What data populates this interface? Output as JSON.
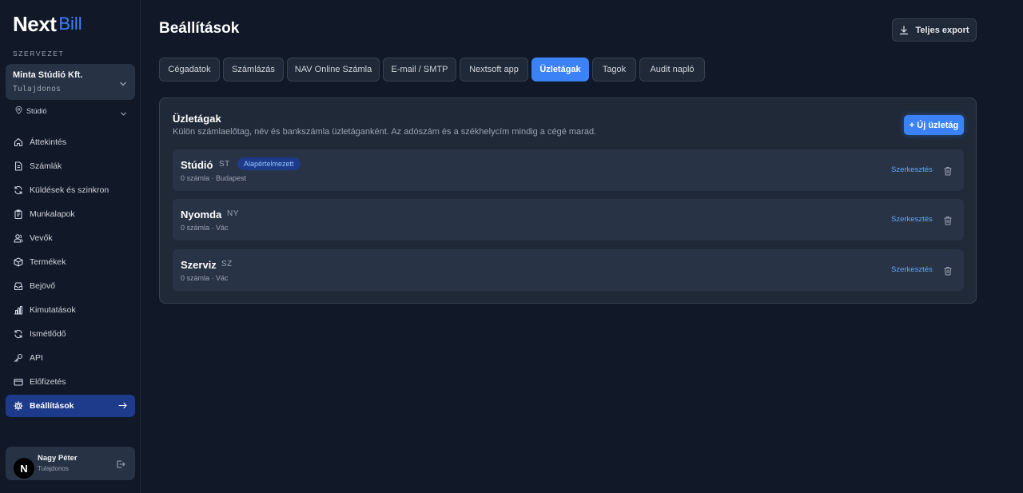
{
  "brand": {
    "name_main": "Next",
    "name_accent": "Bill",
    "accent_color": "#3b82f6"
  },
  "sidebar": {
    "org_section_label": "SZERVEZET",
    "org_name": "Minta Stúdió Kft.",
    "org_role": "Tulajdonos",
    "business_selector": "Stúdió",
    "items": [
      {
        "label": "Áttekintés",
        "icon": "home-icon"
      },
      {
        "label": "Számlák",
        "icon": "document-icon"
      },
      {
        "label": "Küldések és szinkron",
        "icon": "sync-icon"
      },
      {
        "label": "Munkalapok",
        "icon": "clipboard-icon"
      },
      {
        "label": "Vevők",
        "icon": "users-icon"
      },
      {
        "label": "Termékek",
        "icon": "box-icon"
      },
      {
        "label": "Bejövő",
        "icon": "inbox-icon"
      },
      {
        "label": "Kimutatások",
        "icon": "bar-chart-icon"
      },
      {
        "label": "Ismétlődő",
        "icon": "repeat-icon"
      },
      {
        "label": "API",
        "icon": "key-icon"
      },
      {
        "label": "Előfizetés",
        "icon": "credit-card-icon"
      },
      {
        "label": "Beállítások",
        "icon": "gear-icon",
        "active": true
      }
    ],
    "user": {
      "initial": "N",
      "name": "Nagy Péter",
      "role": "Tulajdonos"
    }
  },
  "header": {
    "title": "Beállítások",
    "export_label": "Teljes export"
  },
  "tabs": [
    {
      "label": "Cégadatok"
    },
    {
      "label": "Számlázás"
    },
    {
      "label": "NAV Online Számla"
    },
    {
      "label": "E-mail / SMTP"
    },
    {
      "label": "Nextsoft app"
    },
    {
      "label": "Üzletágak",
      "active": true
    },
    {
      "label": "Tagok"
    },
    {
      "label": "Audit napló"
    }
  ],
  "panel": {
    "title": "Üzletágak",
    "subtitle": "Külön számlaelőtag, név és bankszámla üzletáganként. Az adószám és a székhelycím mindig a cégé marad.",
    "new_button": "+ Új üzletág",
    "edit_label": "Szerkesztés",
    "rows": [
      {
        "name": "Stúdió",
        "code": "ST",
        "badge": "Alapértelmezett",
        "meta": "0 számla · Budapest"
      },
      {
        "name": "Nyomda",
        "code": "NY",
        "badge": "",
        "meta": "0 számla · Vác"
      },
      {
        "name": "Szerviz",
        "code": "SZ",
        "badge": "",
        "meta": "0 számla · Vác"
      }
    ]
  }
}
